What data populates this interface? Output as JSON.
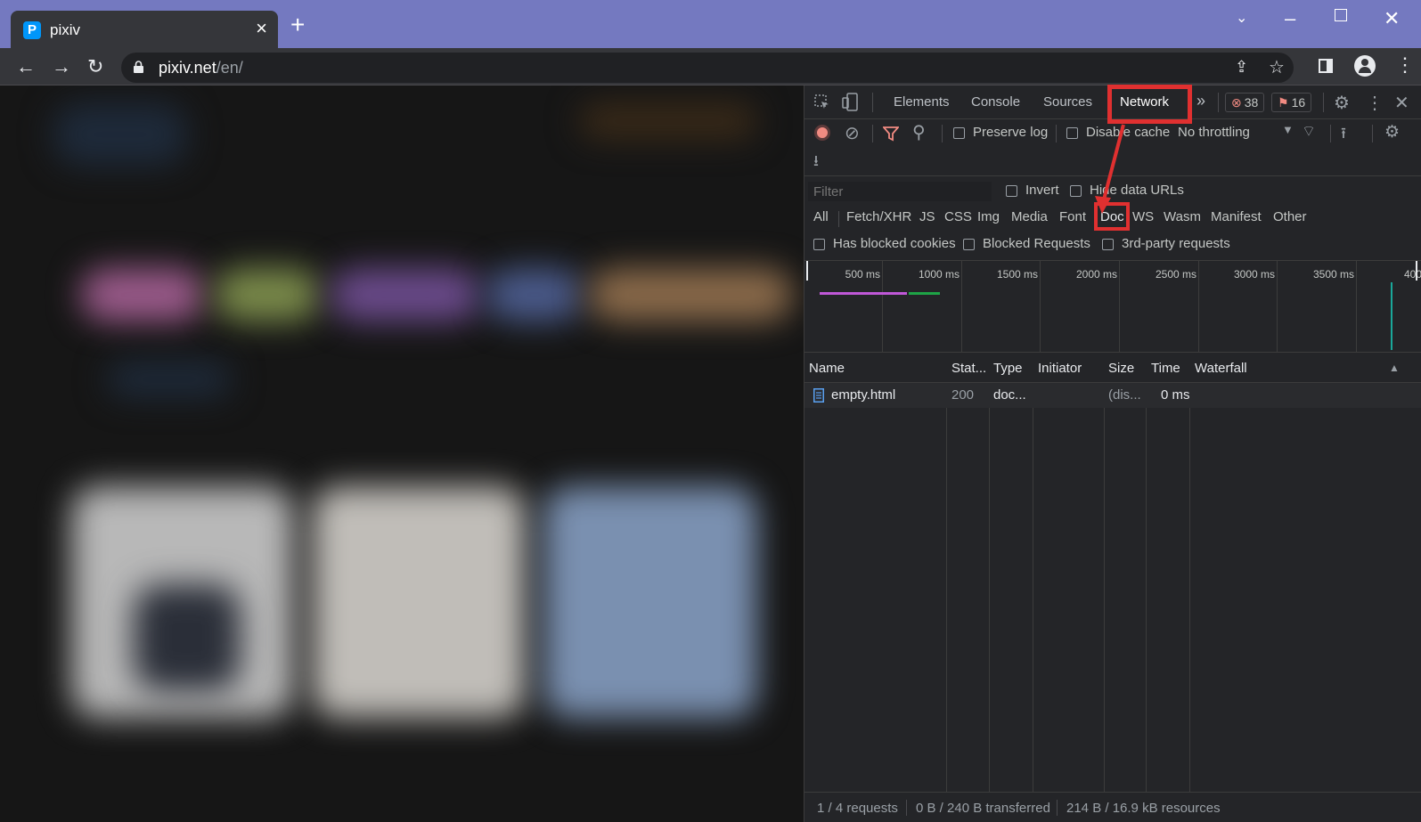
{
  "browser": {
    "tab_title": "pixiv",
    "favicon_letter": "P",
    "url_host": "pixiv.net",
    "url_path": "/en/"
  },
  "devtools": {
    "tabs": [
      "Elements",
      "Console",
      "Sources",
      "Network"
    ],
    "active_tab": "Network",
    "error_count": "38",
    "issue_count": "16",
    "toolbar": {
      "preserve_log": "Preserve log",
      "disable_cache": "Disable cache",
      "throttling": "No throttling"
    },
    "filter": {
      "placeholder": "Filter",
      "invert": "Invert",
      "hide_data_urls": "Hide data URLs"
    },
    "type_filters": [
      "All",
      "Fetch/XHR",
      "JS",
      "CSS",
      "Img",
      "Media",
      "Font",
      "Doc",
      "WS",
      "Wasm",
      "Manifest",
      "Other"
    ],
    "highlighted_filter": "Doc",
    "extra_filters": {
      "blocked_cookies": "Has blocked cookies",
      "blocked_requests": "Blocked Requests",
      "third_party": "3rd-party requests"
    },
    "timeline_ticks": [
      "500 ms",
      "1000 ms",
      "1500 ms",
      "2000 ms",
      "2500 ms",
      "3000 ms",
      "3500 ms",
      "400"
    ],
    "columns": [
      "Name",
      "Stat...",
      "Type",
      "Initiator",
      "Size",
      "Time",
      "Waterfall"
    ],
    "rows": [
      {
        "name": "empty.html",
        "status": "200",
        "type": "doc...",
        "initiator": "",
        "size": "(dis...",
        "time": "0 ms"
      }
    ],
    "status_bar": {
      "requests": "1 / 4 requests",
      "transferred": "0 B / 240 B transferred",
      "resources": "214 B / 16.9 kB resources"
    }
  },
  "colors": {
    "titlebar": "#7479c0",
    "highlight": "#e03030",
    "record": "#f28b82"
  }
}
